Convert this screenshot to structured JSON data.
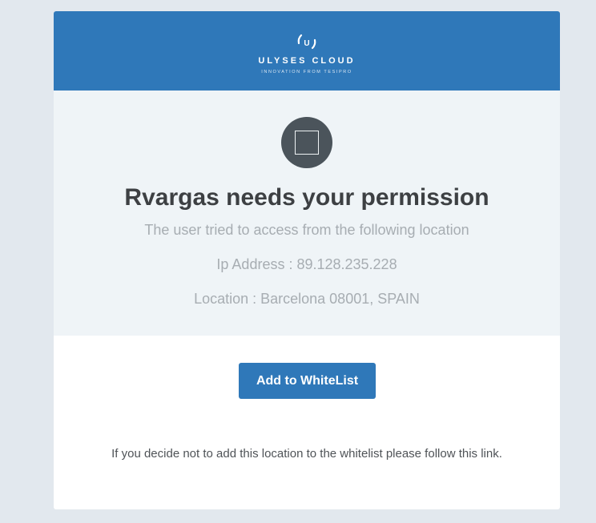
{
  "brand": {
    "name": "ULYSES CLOUD",
    "tagline": "INNOVATION FROM TESIPRO",
    "logo_letter": "U",
    "color": "#2f78b9"
  },
  "info": {
    "avatar_icon": "square-icon",
    "title": "Rvargas needs your permission",
    "subtitle": "The user tried to access from the following location",
    "ip": "Ip Address : 89.128.235.228",
    "location": "Location : Barcelona 08001, SPAIN"
  },
  "actions": {
    "whitelist_button": "Add to WhiteList",
    "note": "If you decide not to add this location to the whitelist please follow this link."
  }
}
